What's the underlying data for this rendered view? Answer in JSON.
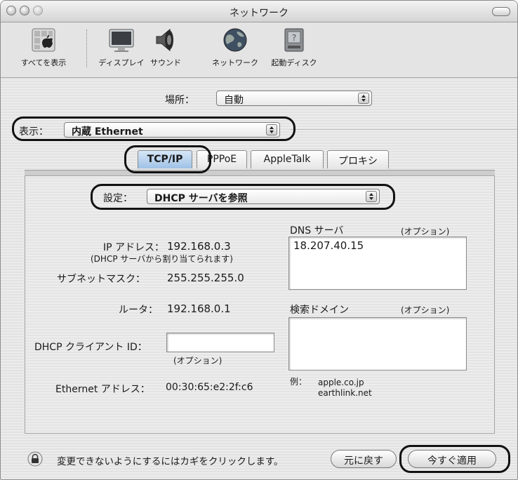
{
  "window": {
    "title": "ネットワーク"
  },
  "toolbar": {
    "items": [
      {
        "label": "すべてを表示"
      },
      {
        "label": "ディスプレイ"
      },
      {
        "label": "サウンド"
      },
      {
        "label": "ネットワーク"
      },
      {
        "label": "起動ディスク"
      }
    ]
  },
  "location": {
    "label": "場所：",
    "value": "自動"
  },
  "show": {
    "label": "表示：",
    "value": "内蔵 Ethernet"
  },
  "tabs": [
    {
      "label": "TCP/IP",
      "selected": true
    },
    {
      "label": "PPPoE"
    },
    {
      "label": "AppleTalk"
    },
    {
      "label": "プロキシ"
    }
  ],
  "configure": {
    "label": "設定：",
    "value": "DHCP サーバを参照"
  },
  "ip": {
    "label": "IP アドレス：",
    "value": "192.168.0.3",
    "note": "(DHCP サーバから割り当てられます)"
  },
  "subnet": {
    "label": "サブネットマスク：",
    "value": "255.255.255.0"
  },
  "router": {
    "label": "ルータ：",
    "value": "192.168.0.1"
  },
  "dhcp_client": {
    "label": "DHCP クライアント ID：",
    "value": "",
    "hint": "(オプション)"
  },
  "ethernet": {
    "label": "Ethernet アドレス：",
    "value": "00:30:65:e2:2f:c6"
  },
  "dns": {
    "label": "DNS サーバ",
    "optional": "(オプション)",
    "value": "18.207.40.15"
  },
  "search_domains": {
    "label": "検索ドメイン",
    "optional": "(オプション)",
    "value": "",
    "example_label": "例：",
    "example_1": "apple.co.jp",
    "example_2": "earthlink.net"
  },
  "lock": {
    "text": "変更できないようにするにはカギをクリックします。"
  },
  "buttons": {
    "revert": "元に戻す",
    "apply": "今すぐ適用"
  }
}
